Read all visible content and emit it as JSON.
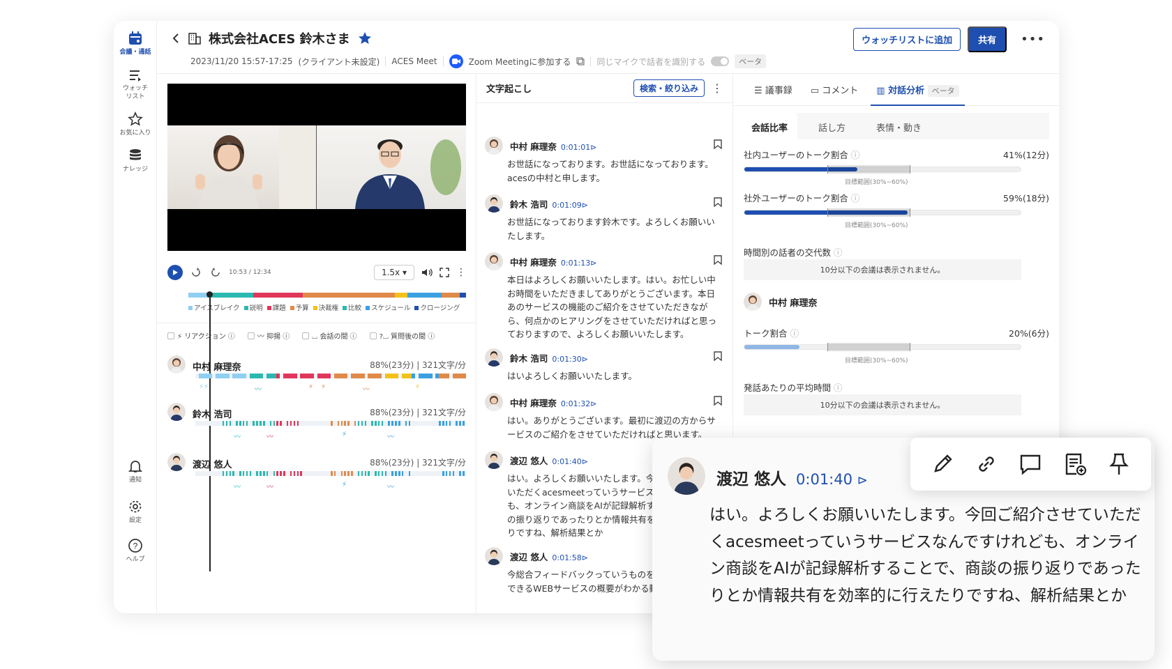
{
  "rail": {
    "meetings": "会議・通話",
    "watch1": "ウォッチ",
    "watch2": "リスト",
    "favorites": "お気に入り",
    "knowledge": "ナレッジ",
    "notifications": "通知",
    "settings": "設定",
    "help": "ヘルプ"
  },
  "header": {
    "title": "株式会社ACES 鈴木さま",
    "datetime": "2023/11/20 15:57-17:25",
    "client": "(クライアント未設定)",
    "tool": "ACES Meet",
    "zoom": "Zoom Meetingに参加する",
    "mic": "同じマイクで話者を識別する",
    "beta": "ベータ",
    "watchlist": "ウォッチリストに追加",
    "share": "共有"
  },
  "player": {
    "time": "10:53 / 12:34",
    "speed": "1.5x",
    "back": "15",
    "fwd": "15"
  },
  "timeline": {
    "segments": [
      {
        "color": "#8fcff2",
        "w": 6
      },
      {
        "color": "#2bb8b0",
        "w": 15
      },
      {
        "color": "#e0365a",
        "w": 16
      },
      {
        "color": "#e08a4a",
        "w": 30
      },
      {
        "color": "#f2c21a",
        "w": 4
      },
      {
        "color": "#3aa0e0",
        "w": 11
      },
      {
        "color": "#e08a4a",
        "w": 6
      },
      {
        "color": "#1e4fb0",
        "w": 2
      }
    ],
    "legend": [
      {
        "label": "アイスブレイク",
        "color": "#8fcff2"
      },
      {
        "label": "説明",
        "color": "#2bb8b0"
      },
      {
        "label": "課題",
        "color": "#e0365a"
      },
      {
        "label": "予算",
        "color": "#e08a4a"
      },
      {
        "label": "決裁権",
        "color": "#f2c21a"
      },
      {
        "label": "比較",
        "color": "#2bb8b0"
      },
      {
        "label": "スケジュール",
        "color": "#3aa0e0"
      },
      {
        "label": "クロージング",
        "color": "#1e4fb0"
      }
    ]
  },
  "filters": [
    "リアクション",
    "抑揚",
    "会話の間",
    "質問後の間"
  ],
  "speakers": [
    {
      "name": "中村 麻理奈",
      "ratio": "88%(23分)",
      "speed": "321文字/分"
    },
    {
      "name": "鈴木 浩司",
      "ratio": "88%(23分)",
      "speed": "321文字/分"
    },
    {
      "name": "渡辺 悠人",
      "ratio": "88%(23分)",
      "speed": "321文字/分"
    }
  ],
  "transcript": {
    "title": "文字起こし",
    "filter": "検索・絞り込み",
    "messages": [
      {
        "name": "中村 麻理奈",
        "time": "0:01:01",
        "text": "お世話になっております。お世話になっております。acesの中村と申します。"
      },
      {
        "name": "鈴木 浩司",
        "time": "0:01:09",
        "text": "お世話になっております鈴木です。よろしくお願いいたします。"
      },
      {
        "name": "中村 麻理奈",
        "time": "0:01:13",
        "text": "本日はよろしくお願いいたします。はい。お忙しい中お時間をいただきましてありがとうございます。本日あのサービスの機能のご紹介をさせていただきながら、何点かのヒアリングをさせていただければと思っておりますので、よろしくお願いいたします。"
      },
      {
        "name": "鈴木 浩司",
        "time": "0:01:30",
        "text": "はいよろしくお願いいたします。"
      },
      {
        "name": "中村 麻理奈",
        "time": "0:01:32",
        "text": "はい。ありがとうございます。最初に渡辺の方からサービスのご紹介をさせていただければと思います。"
      },
      {
        "name": "渡辺 悠人",
        "time": "0:01:40",
        "text": "はい。よろしくお願いいたします。今回ご紹介させていただくacesmeetっていうサービスなんですけれども、オンライン商談をAIが記録解析することで、商談の振り返りであったりとか情報共有を効率的に行えたりですね、解析結果とか"
      },
      {
        "name": "渡辺 悠人",
        "time": "0:01:58",
        "text": "今総合フィードバックっていうものを向上することのできるWEBサービスの概要がわかる動画をまずお"
      }
    ]
  },
  "analysis": {
    "tabs": [
      "議事録",
      "コメント",
      "対話分析"
    ],
    "tab_beta": "ベータ",
    "subtabs": [
      "会話比率",
      "話し方",
      "表情・動き"
    ],
    "internal_label": "社内ユーザーのトーク割合",
    "internal_val": "41%(12分)",
    "internal_pct": 41,
    "external_label": "社外ユーザーのトーク割合",
    "external_val": "59%(18分)",
    "external_pct": 59,
    "range": "目標範囲(30%~60%)",
    "switch_label": "時間別の話者の交代数",
    "not_shown": "10分以下の会議は表示されません。",
    "person": "中村 麻理奈",
    "talk_label": "トーク割合",
    "talk_val": "20%(6分)",
    "talk_pct": 20,
    "avg_label": "発話あたりの平均時間"
  },
  "popup": {
    "name": "渡辺 悠人",
    "time": "0:01:40",
    "text": "はい。よろしくお願いいたします。今回ご紹介させていただくacesmeetっていうサービスなんですけれども、オンライン商談をAIが記録解析することで、商談の振り返りであったりとか情報共有を効率的に行えたりですね、解析結果とか"
  },
  "colors": {
    "accent": "#1e4fb0",
    "teal": "#2bb8b0",
    "red": "#e0365a",
    "orange": "#e08a4a",
    "light": "#8fcff2"
  }
}
